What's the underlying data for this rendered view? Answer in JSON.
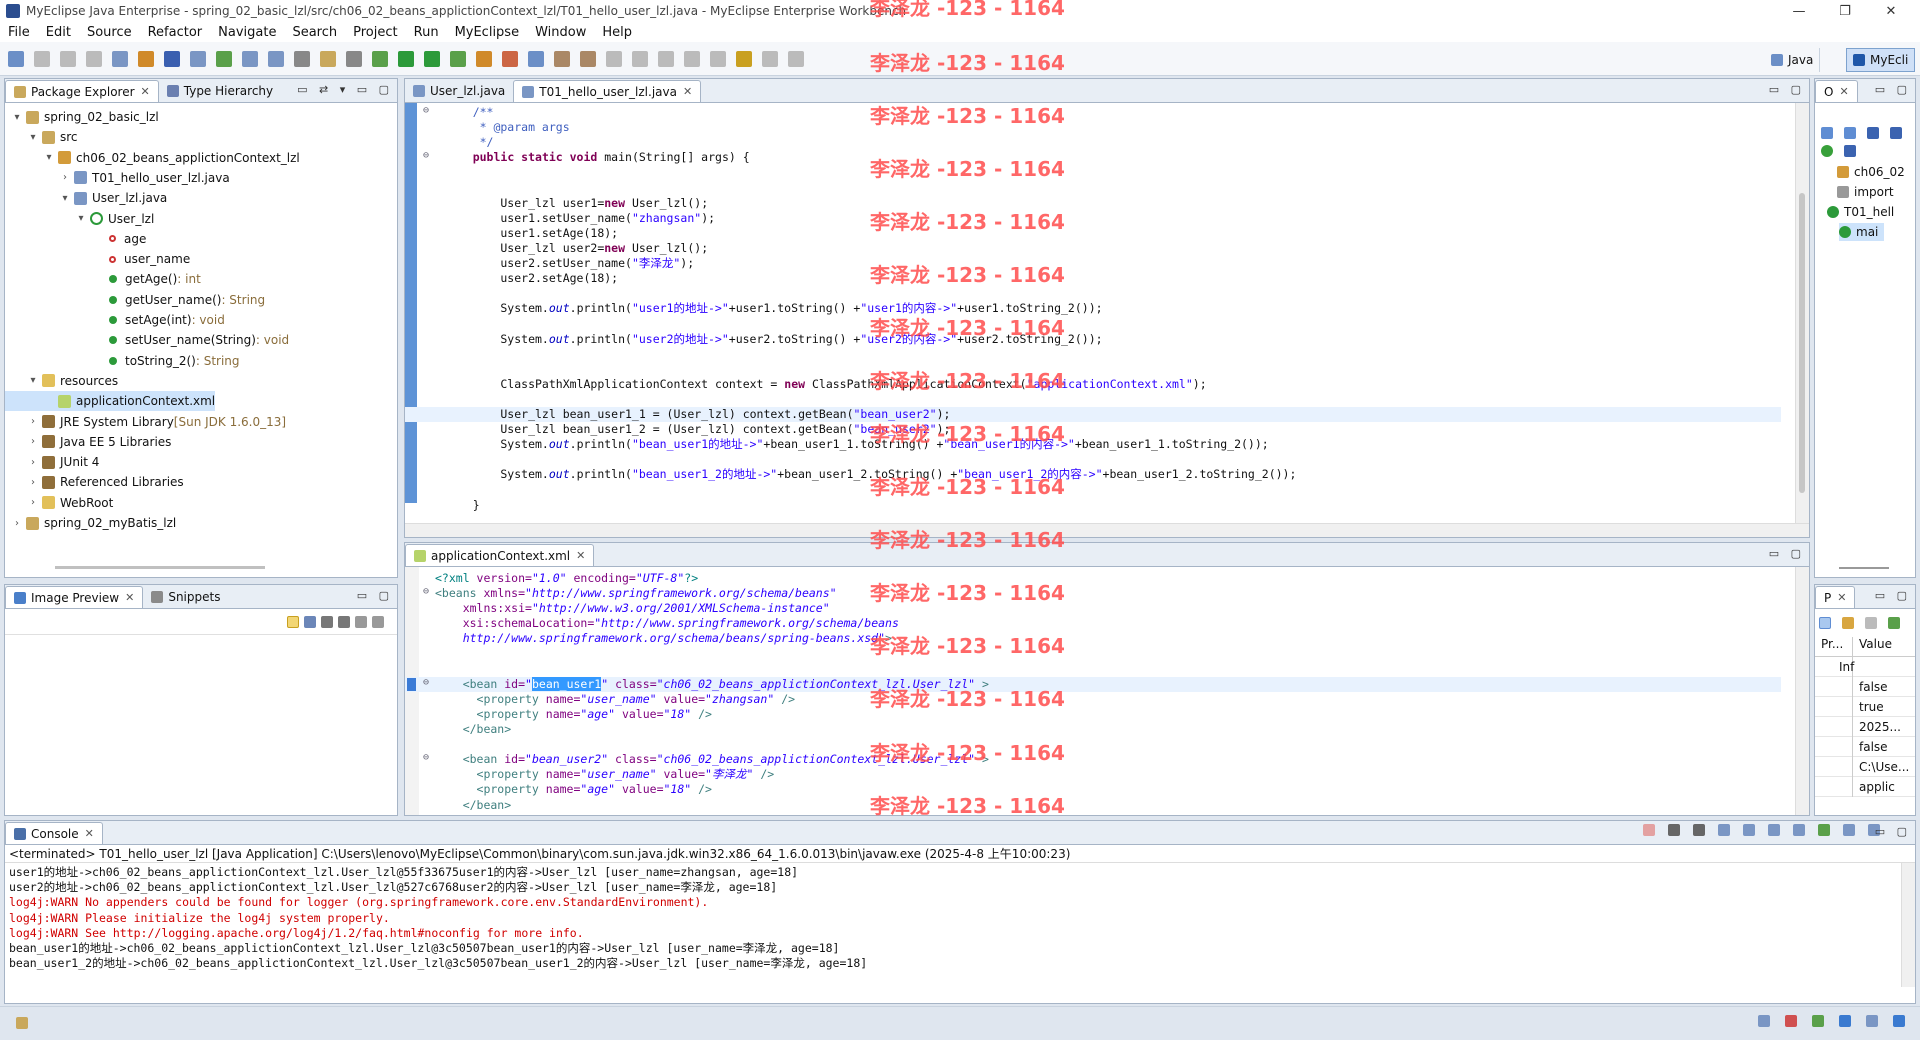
{
  "window": {
    "title": "MyEclipse Java Enterprise - spring_02_basic_lzl/src/ch06_02_beans_applictionContext_lzl/T01_hello_user_lzl.java - MyEclipse Enterprise Workbench"
  },
  "menu": [
    "File",
    "Edit",
    "Source",
    "Refactor",
    "Navigate",
    "Search",
    "Project",
    "Run",
    "MyEclipse",
    "Window",
    "Help"
  ],
  "perspectives": {
    "java": "Java",
    "myecli": "MyEcli"
  },
  "watermark": "李泽龙 -123 - 1164",
  "package_explorer": {
    "tabs": [
      "Package Explorer",
      "Type Hierarchy"
    ],
    "tree": [
      {
        "label": "spring_02_basic_lzl",
        "depth": 0,
        "tw": "▾",
        "kind": "project"
      },
      {
        "label": "src",
        "depth": 1,
        "tw": "▾",
        "kind": "srcfolder"
      },
      {
        "label": "ch06_02_beans_applictionContext_lzl",
        "depth": 2,
        "tw": "▾",
        "kind": "package"
      },
      {
        "label": "T01_hello_user_lzl.java",
        "depth": 3,
        "tw": "›",
        "kind": "java"
      },
      {
        "label": "User_lzl.java",
        "depth": 3,
        "tw": "▾",
        "kind": "java"
      },
      {
        "label": "User_lzl",
        "depth": 4,
        "tw": "▾",
        "kind": "class"
      },
      {
        "label": "age",
        "depth": 5,
        "tw": "",
        "kind": "field"
      },
      {
        "label": "user_name",
        "depth": 5,
        "tw": "",
        "kind": "field"
      },
      {
        "label": "getAge()",
        "suffix": " : int",
        "depth": 5,
        "tw": "",
        "kind": "method"
      },
      {
        "label": "getUser_name()",
        "suffix": " : String",
        "depth": 5,
        "tw": "",
        "kind": "method"
      },
      {
        "label": "setAge(int)",
        "suffix": " : void",
        "depth": 5,
        "tw": "",
        "kind": "method"
      },
      {
        "label": "setUser_name(String)",
        "suffix": " : void",
        "depth": 5,
        "tw": "",
        "kind": "method"
      },
      {
        "label": "toString_2()",
        "suffix": " : String",
        "depth": 5,
        "tw": "",
        "kind": "method"
      },
      {
        "label": "resources",
        "depth": 1,
        "tw": "▾",
        "kind": "folder"
      },
      {
        "label": "applicationContext.xml",
        "depth": 2,
        "tw": "",
        "kind": "xml",
        "selected": true
      },
      {
        "label": "JRE System Library",
        "suffix": " [Sun JDK 1.6.0_13]",
        "depth": 1,
        "tw": "›",
        "kind": "lib"
      },
      {
        "label": "Java EE 5 Libraries",
        "depth": 1,
        "tw": "›",
        "kind": "lib"
      },
      {
        "label": "JUnit 4",
        "depth": 1,
        "tw": "›",
        "kind": "lib"
      },
      {
        "label": "Referenced Libraries",
        "depth": 1,
        "tw": "›",
        "kind": "lib"
      },
      {
        "label": "WebRoot",
        "depth": 1,
        "tw": "›",
        "kind": "folder"
      },
      {
        "label": "spring_02_myBatis_lzl",
        "depth": 0,
        "tw": "›",
        "kind": "project"
      }
    ]
  },
  "image_preview": {
    "tabs": [
      "Image Preview",
      "Snippets"
    ]
  },
  "editor": {
    "tabs": [
      "User_lzl.java",
      "T01_hello_user_lzl.java"
    ],
    "lines": [
      [
        {
          "t": "    /**",
          "c": "cm"
        }
      ],
      [
        {
          "t": "     * @param args",
          "c": "cm"
        }
      ],
      [
        {
          "t": "     */",
          "c": "cm"
        }
      ],
      [
        {
          "t": "    ",
          "c": ""
        },
        {
          "t": "public static void",
          "c": "kw"
        },
        {
          "t": " main(String[] args) {",
          "c": ""
        }
      ],
      [
        {
          "t": "",
          "c": ""
        }
      ],
      [
        {
          "t": "",
          "c": ""
        }
      ],
      [
        {
          "t": "        User_lzl user1=",
          "c": ""
        },
        {
          "t": "new",
          "c": "kw"
        },
        {
          "t": " User_lzl();",
          "c": ""
        }
      ],
      [
        {
          "t": "        user1.setUser_name(",
          "c": ""
        },
        {
          "t": "\"zhangsan\"",
          "c": "str"
        },
        {
          "t": ");",
          "c": ""
        }
      ],
      [
        {
          "t": "        user1.setAge(18);",
          "c": ""
        }
      ],
      [
        {
          "t": "        User_lzl user2=",
          "c": ""
        },
        {
          "t": "new",
          "c": "kw"
        },
        {
          "t": " User_lzl();",
          "c": ""
        }
      ],
      [
        {
          "t": "        user2.setUser_name(",
          "c": ""
        },
        {
          "t": "\"李泽龙\"",
          "c": "str"
        },
        {
          "t": ");",
          "c": ""
        }
      ],
      [
        {
          "t": "        user2.setAge(18);",
          "c": ""
        }
      ],
      [
        {
          "t": "",
          "c": ""
        }
      ],
      [
        {
          "t": "        System.",
          "c": ""
        },
        {
          "t": "out",
          "c": "fld"
        },
        {
          "t": ".println(",
          "c": ""
        },
        {
          "t": "\"user1的地址->\"",
          "c": "str"
        },
        {
          "t": "+user1.toString() +",
          "c": ""
        },
        {
          "t": "\"user1的内容->\"",
          "c": "str"
        },
        {
          "t": "+user1.toString_2());",
          "c": ""
        }
      ],
      [
        {
          "t": "",
          "c": ""
        }
      ],
      [
        {
          "t": "        System.",
          "c": ""
        },
        {
          "t": "out",
          "c": "fld"
        },
        {
          "t": ".println(",
          "c": ""
        },
        {
          "t": "\"user2的地址->\"",
          "c": "str"
        },
        {
          "t": "+user2.toString() +",
          "c": ""
        },
        {
          "t": "\"user2的内容->\"",
          "c": "str"
        },
        {
          "t": "+user2.toString_2());",
          "c": ""
        }
      ],
      [
        {
          "t": "",
          "c": ""
        }
      ],
      [
        {
          "t": "",
          "c": ""
        }
      ],
      [
        {
          "t": "        ClassPathXmlApplicationContext context = ",
          "c": ""
        },
        {
          "t": "new",
          "c": "kw"
        },
        {
          "t": " ClassPathXmlApplicationContext(",
          "c": ""
        },
        {
          "t": "\"applicationContext.xml\"",
          "c": "str"
        },
        {
          "t": ");",
          "c": ""
        }
      ],
      [
        {
          "t": "",
          "c": ""
        }
      ],
      [
        {
          "t": "        User_lzl bean_user1_1 = (User_lzl) context.getBean(",
          "c": ""
        },
        {
          "t": "\"bean_user2\"",
          "c": "str"
        },
        {
          "t": ");",
          "c": ""
        }
      ],
      [
        {
          "t": "        User_lzl bean_user1_2 = (User_lzl) context.getBean(",
          "c": ""
        },
        {
          "t": "\"bean_user2\"",
          "c": "str"
        },
        {
          "t": ");",
          "c": ""
        }
      ],
      [
        {
          "t": "        System.",
          "c": ""
        },
        {
          "t": "out",
          "c": "fld"
        },
        {
          "t": ".println(",
          "c": ""
        },
        {
          "t": "\"bean_user1的地址->\"",
          "c": "str"
        },
        {
          "t": "+bean_user1_1.toString() +",
          "c": ""
        },
        {
          "t": "\"bean_user1的内容->\"",
          "c": "str"
        },
        {
          "t": "+bean_user1_1.toString_2());",
          "c": ""
        }
      ],
      [
        {
          "t": "",
          "c": ""
        }
      ],
      [
        {
          "t": "        System.",
          "c": ""
        },
        {
          "t": "out",
          "c": "fld"
        },
        {
          "t": ".println(",
          "c": ""
        },
        {
          "t": "\"bean_user1_2的地址->\"",
          "c": "str"
        },
        {
          "t": "+bean_user1_2.toString() +",
          "c": ""
        },
        {
          "t": "\"bean_user1_2的内容->\"",
          "c": "str"
        },
        {
          "t": "+bean_user1_2.toString_2());",
          "c": ""
        }
      ],
      [
        {
          "t": "",
          "c": ""
        }
      ],
      [
        {
          "t": "    }",
          "c": ""
        }
      ]
    ]
  },
  "xml_editor": {
    "tab": "applicationContext.xml",
    "lines": [
      [
        {
          "t": "<?xml ",
          "c": "xpi"
        },
        {
          "t": "version=",
          "c": "xattr"
        },
        {
          "t": "\"1.0\"",
          "c": "xval"
        },
        {
          "t": " encoding=",
          "c": "xattr"
        },
        {
          "t": "\"UTF-8\"",
          "c": "xval"
        },
        {
          "t": "?>",
          "c": "xpi"
        }
      ],
      [
        {
          "t": "<beans ",
          "c": "xtag"
        },
        {
          "t": "xmlns=",
          "c": "xattr"
        },
        {
          "t": "\"http://www.springframework.org/schema/beans\"",
          "c": "xval"
        }
      ],
      [
        {
          "t": "    xmlns:xsi=",
          "c": "xattr"
        },
        {
          "t": "\"http://www.w3.org/2001/XMLSchema-instance\"",
          "c": "xval"
        }
      ],
      [
        {
          "t": "    xsi:schemaLocation=",
          "c": "xattr"
        },
        {
          "t": "\"http://www.springframework.org/schema/beans",
          "c": "xval"
        }
      ],
      [
        {
          "t": "    http://www.springframework.org/schema/beans/spring-beans.xsd\"",
          "c": "xval"
        },
        {
          "t": ">",
          "c": "xtag"
        }
      ],
      [
        {
          "t": "",
          "c": ""
        }
      ],
      [
        {
          "t": "",
          "c": ""
        }
      ],
      [
        {
          "t": "    <bean ",
          "c": "xtag"
        },
        {
          "t": "id=",
          "c": "xattr"
        },
        {
          "t": "\"",
          "c": "xval"
        },
        {
          "t": "bean_user1",
          "c": "sel"
        },
        {
          "t": "\"",
          "c": "xval"
        },
        {
          "t": " class=",
          "c": "xattr"
        },
        {
          "t": "\"ch06_02_beans_applictionContext_lzl.User_lzl\"",
          "c": "xval"
        },
        {
          "t": " >",
          "c": "xtag"
        }
      ],
      [
        {
          "t": "      <property ",
          "c": "xtag"
        },
        {
          "t": "name=",
          "c": "xattr"
        },
        {
          "t": "\"user_name\"",
          "c": "xval"
        },
        {
          "t": " value=",
          "c": "xattr"
        },
        {
          "t": "\"zhangsan\"",
          "c": "xval"
        },
        {
          "t": " />",
          "c": "xtag"
        }
      ],
      [
        {
          "t": "      <property ",
          "c": "xtag"
        },
        {
          "t": "name=",
          "c": "xattr"
        },
        {
          "t": "\"age\"",
          "c": "xval"
        },
        {
          "t": " value=",
          "c": "xattr"
        },
        {
          "t": "\"18\"",
          "c": "xval"
        },
        {
          "t": " />",
          "c": "xtag"
        }
      ],
      [
        {
          "t": "    </bean>",
          "c": "xtag"
        }
      ],
      [
        {
          "t": "",
          "c": ""
        }
      ],
      [
        {
          "t": "    <bean ",
          "c": "xtag"
        },
        {
          "t": "id=",
          "c": "xattr"
        },
        {
          "t": "\"bean_user2\"",
          "c": "xval"
        },
        {
          "t": " class=",
          "c": "xattr"
        },
        {
          "t": "\"ch06_02_beans_applictionContext_lzl.User_lzl\"",
          "c": "xval"
        },
        {
          "t": " >",
          "c": "xtag"
        }
      ],
      [
        {
          "t": "      <property ",
          "c": "xtag"
        },
        {
          "t": "name=",
          "c": "xattr"
        },
        {
          "t": "\"user_name\"",
          "c": "xval"
        },
        {
          "t": " value=",
          "c": "xattr"
        },
        {
          "t": "\"李泽龙\"",
          "c": "xval"
        },
        {
          "t": " />",
          "c": "xtag"
        }
      ],
      [
        {
          "t": "      <property ",
          "c": "xtag"
        },
        {
          "t": "name=",
          "c": "xattr"
        },
        {
          "t": "\"age\"",
          "c": "xval"
        },
        {
          "t": " value=",
          "c": "xattr"
        },
        {
          "t": "\"18\"",
          "c": "xval"
        },
        {
          "t": " />",
          "c": "xtag"
        }
      ],
      [
        {
          "t": "    </bean>",
          "c": "xtag"
        }
      ]
    ]
  },
  "outline": {
    "tab": "O",
    "items": [
      "ch06_02",
      "import",
      "T01_hell",
      "mai"
    ]
  },
  "properties": {
    "tab": "P",
    "headers": [
      "Pr...",
      "Value"
    ],
    "values": [
      "Inf",
      "false",
      "true",
      "2025...",
      "false",
      "C:\\Use...",
      "applic"
    ]
  },
  "console": {
    "tab": "Console",
    "header": "<terminated> T01_hello_user_lzl [Java Application] C:\\Users\\lenovo\\MyEclipse\\Common\\binary\\com.sun.java.jdk.win32.x86_64_1.6.0.013\\bin\\javaw.exe (2025-4-8 上午10:00:23)",
    "lines": [
      {
        "t": "user1的地址->ch06_02_beans_applictionContext_lzl.User_lzl@55f33675user1的内容->User_lzl [user_name=zhangsan, age=18]",
        "err": false
      },
      {
        "t": "user2的地址->ch06_02_beans_applictionContext_lzl.User_lzl@527c6768user2的内容->User_lzl [user_name=李泽龙, age=18]",
        "err": false
      },
      {
        "t": "log4j:WARN No appenders could be found for logger (org.springframework.core.env.StandardEnvironment).",
        "err": true
      },
      {
        "t": "log4j:WARN Please initialize the log4j system properly.",
        "err": true
      },
      {
        "t": "log4j:WARN See http://logging.apache.org/log4j/1.2/faq.html#noconfig for more info.",
        "err": true
      },
      {
        "t": "bean_user1的地址->ch06_02_beans_applictionContext_lzl.User_lzl@3c50507bean_user1的内容->User_lzl [user_name=李泽龙, age=18]",
        "err": false
      },
      {
        "t": "bean_user1_2的地址->ch06_02_beans_applictionContext_lzl.User_lzl@3c50507bean_user1_2的内容->User_lzl [user_name=李泽龙, age=18]",
        "err": false
      }
    ]
  }
}
